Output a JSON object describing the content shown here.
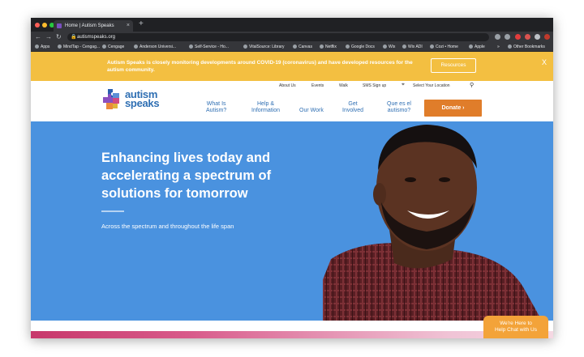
{
  "browser": {
    "tab_title": "Home | Autism Speaks",
    "tab_close": "×",
    "new_tab": "+",
    "url": "autismspeaks.org",
    "bookmarks": [
      "Apps",
      "MindTap - Cengag...",
      "Cengage",
      "Anderson Universi...",
      "Self-Service - Ho...",
      "VitalSource: Library",
      "Canvas",
      "Netflix",
      "Google Docs",
      "Wix",
      "Wix ADI",
      "Cozi • Home",
      "Apple",
      "»",
      "Other Bookmarks"
    ]
  },
  "banner": {
    "text": "Autism Speaks is closely monitoring developments around COVID-19 (coronavirus) and have developed resources for the autism community.",
    "button": "Resources",
    "close": "X"
  },
  "header": {
    "logo_line1": "autism",
    "logo_line2": "speaks",
    "utility": [
      "About Us",
      "Events",
      "Walk",
      "SMS Sign up",
      "Select Your Location"
    ],
    "nav": [
      {
        "line1": "What Is",
        "line2": "Autism?"
      },
      {
        "line1": "Help &",
        "line2": "Information"
      },
      {
        "line1": "",
        "line2": "Our Work"
      },
      {
        "line1": "Get",
        "line2": "Involved"
      },
      {
        "line1": "Que es el",
        "line2": "autismo?"
      }
    ],
    "donate": "Donate ›"
  },
  "hero": {
    "title": "Enhancing lives today and accelerating a spectrum of solutions for tomorrow",
    "subtitle": "Across the spectrum and throughout the life span"
  },
  "chat": {
    "line1": "We're Here to",
    "line2": "Help Chat with Us"
  },
  "colors": {
    "brand_blue": "#2f6fb3",
    "banner_yellow": "#f3bf41",
    "donate_orange": "#e07d2a",
    "hero_blue": "#4a92df"
  }
}
